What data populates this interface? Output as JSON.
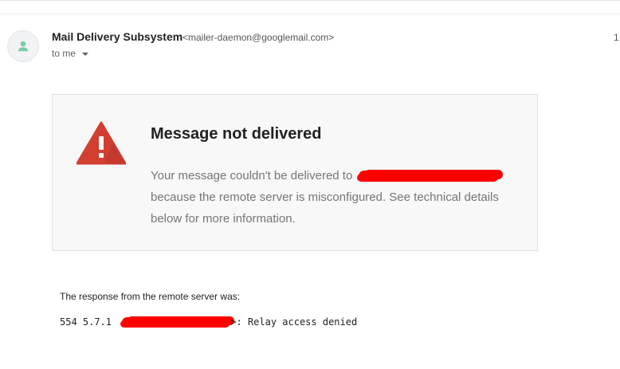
{
  "header": {
    "sender_name": "Mail Delivery Subsystem",
    "sender_email": "<mailer-daemon@googlemail.com>",
    "recipients": "to me",
    "timestamp": "1"
  },
  "card": {
    "title": "Message not delivered",
    "body_prefix": "Your message couldn't be delivered to",
    "body_suffix": "because the remote server is misconfigured. See technical details below for more information."
  },
  "response": {
    "label": "The response from the remote server was:",
    "code": "554 5.7.1",
    "message": ">: Relay access denied"
  },
  "colors": {
    "warning": "#d23f31",
    "redaction": "#ff0000"
  },
  "icons": {
    "avatar": "person-icon",
    "warning": "warning-icon",
    "caret": "chevron-down-icon"
  }
}
